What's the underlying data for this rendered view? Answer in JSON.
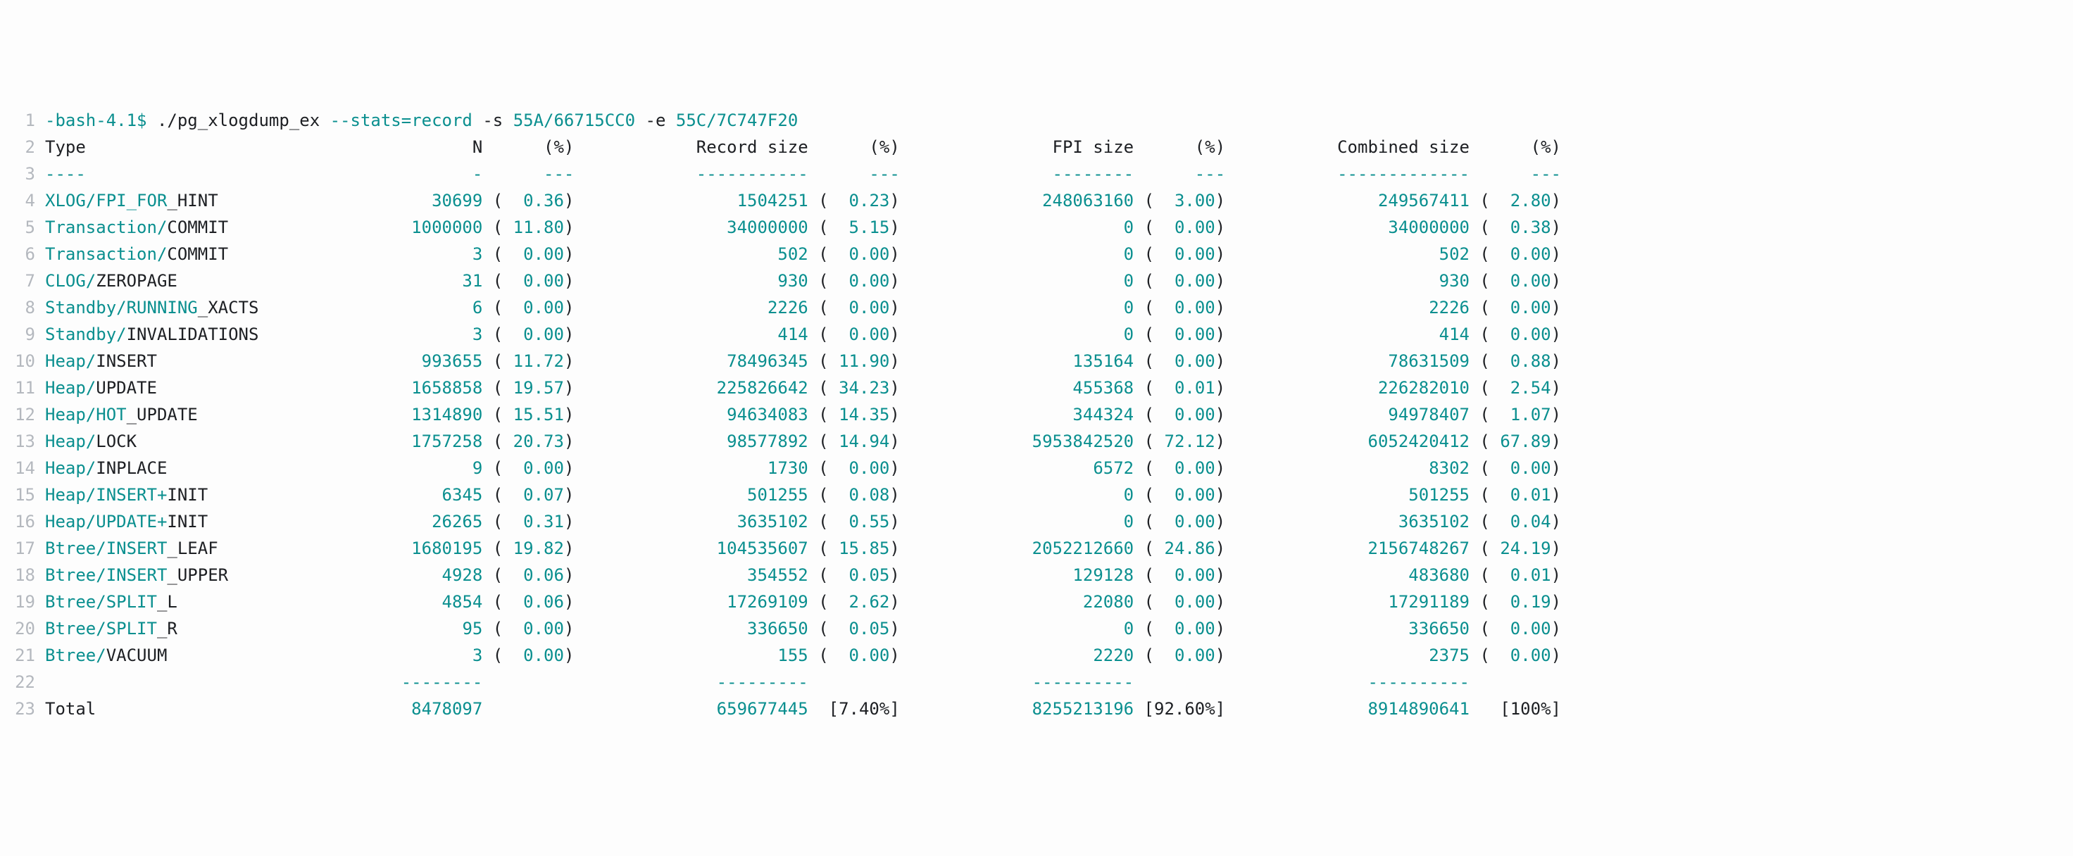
{
  "prompt": {
    "ps1": "-bash-4.1$ ",
    "cmd1": "./pg_xlogdump_ex ",
    "opt1": "--stats=record",
    "flag_s": " -s ",
    "arg_s": "55A/66715CC0",
    "flag_e": " -e ",
    "arg_e": "55C/7C747F20"
  },
  "hdr": {
    "type": "Type",
    "n": "N",
    "pct": "(%)",
    "rsize": "Record size",
    "fsize": "FPI size",
    "csize": "Combined size"
  },
  "div1": {
    "a": "----",
    "b": "-",
    "c": "---",
    "d": "-----------",
    "e": "---",
    "f": "--------",
    "g": "---",
    "h": "-------------",
    "i": "---"
  },
  "rows": [
    {
      "t1": "XLOG/FPI_FOR",
      "t2": "_HINT",
      "n": "30699",
      "np": "0.36",
      "rs": "1504251",
      "rp": "0.23",
      "fs": "248063160",
      "fp": "3.00",
      "cs": "249567411",
      "cp": "2.80"
    },
    {
      "t1": "Transaction/",
      "t2": "COMMIT",
      "n": "1000000",
      "np": "11.80",
      "rs": "34000000",
      "rp": "5.15",
      "fs": "0",
      "fp": "0.00",
      "cs": "34000000",
      "cp": "0.38"
    },
    {
      "t1": "Transaction/",
      "t2": "COMMIT",
      "n": "3",
      "np": "0.00",
      "rs": "502",
      "rp": "0.00",
      "fs": "0",
      "fp": "0.00",
      "cs": "502",
      "cp": "0.00"
    },
    {
      "t1": "CLOG/",
      "t2": "ZEROPAGE",
      "n": "31",
      "np": "0.00",
      "rs": "930",
      "rp": "0.00",
      "fs": "0",
      "fp": "0.00",
      "cs": "930",
      "cp": "0.00"
    },
    {
      "t1": "Standby/RUNNING",
      "t2": "_XACTS",
      "n": "6",
      "np": "0.00",
      "rs": "2226",
      "rp": "0.00",
      "fs": "0",
      "fp": "0.00",
      "cs": "2226",
      "cp": "0.00"
    },
    {
      "t1": "Standby/",
      "t2": "INVALIDATIONS",
      "n": "3",
      "np": "0.00",
      "rs": "414",
      "rp": "0.00",
      "fs": "0",
      "fp": "0.00",
      "cs": "414",
      "cp": "0.00"
    },
    {
      "t1": "Heap/",
      "t2": "INSERT",
      "n": "993655",
      "np": "11.72",
      "rs": "78496345",
      "rp": "11.90",
      "fs": "135164",
      "fp": "0.00",
      "cs": "78631509",
      "cp": "0.88"
    },
    {
      "t1": "Heap/",
      "t2": "UPDATE",
      "n": "1658858",
      "np": "19.57",
      "rs": "225826642",
      "rp": "34.23",
      "fs": "455368",
      "fp": "0.01",
      "cs": "226282010",
      "cp": "2.54"
    },
    {
      "t1": "Heap/HOT",
      "t2": "_UPDATE",
      "n": "1314890",
      "np": "15.51",
      "rs": "94634083",
      "rp": "14.35",
      "fs": "344324",
      "fp": "0.00",
      "cs": "94978407",
      "cp": "1.07"
    },
    {
      "t1": "Heap/",
      "t2": "LOCK",
      "n": "1757258",
      "np": "20.73",
      "rs": "98577892",
      "rp": "14.94",
      "fs": "5953842520",
      "fp": "72.12",
      "cs": "6052420412",
      "cp": "67.89"
    },
    {
      "t1": "Heap/",
      "t2": "INPLACE",
      "n": "9",
      "np": "0.00",
      "rs": "1730",
      "rp": "0.00",
      "fs": "6572",
      "fp": "0.00",
      "cs": "8302",
      "cp": "0.00"
    },
    {
      "t1": "Heap/INSERT+",
      "t2": "INIT",
      "n": "6345",
      "np": "0.07",
      "rs": "501255",
      "rp": "0.08",
      "fs": "0",
      "fp": "0.00",
      "cs": "501255",
      "cp": "0.01"
    },
    {
      "t1": "Heap/UPDATE+",
      "t2": "INIT",
      "n": "26265",
      "np": "0.31",
      "rs": "3635102",
      "rp": "0.55",
      "fs": "0",
      "fp": "0.00",
      "cs": "3635102",
      "cp": "0.04"
    },
    {
      "t1": "Btree/INSERT",
      "t2": "_LEAF",
      "n": "1680195",
      "np": "19.82",
      "rs": "104535607",
      "rp": "15.85",
      "fs": "2052212660",
      "fp": "24.86",
      "cs": "2156748267",
      "cp": "24.19"
    },
    {
      "t1": "Btree/INSERT",
      "t2": "_UPPER",
      "n": "4928",
      "np": "0.06",
      "rs": "354552",
      "rp": "0.05",
      "fs": "129128",
      "fp": "0.00",
      "cs": "483680",
      "cp": "0.01"
    },
    {
      "t1": "Btree/SPLIT",
      "t2": "_L",
      "n": "4854",
      "np": "0.06",
      "rs": "17269109",
      "rp": "2.62",
      "fs": "22080",
      "fp": "0.00",
      "cs": "17291189",
      "cp": "0.19"
    },
    {
      "t1": "Btree/SPLIT",
      "t2": "_R",
      "n": "95",
      "np": "0.00",
      "rs": "336650",
      "rp": "0.05",
      "fs": "0",
      "fp": "0.00",
      "cs": "336650",
      "cp": "0.00"
    },
    {
      "t1": "Btree/",
      "t2": "VACUUM",
      "n": "3",
      "np": "0.00",
      "rs": "155",
      "rp": "0.00",
      "fs": "2220",
      "fp": "0.00",
      "cs": "2375",
      "cp": "0.00"
    }
  ],
  "div2": {
    "a": "--------",
    "b": "---------",
    "c": "----------",
    "d": "----------"
  },
  "total": {
    "label": "Total",
    "n": "8478097",
    "rs": "659677445",
    "rp": "[7.40%]",
    "fs": "8255213196",
    "fp": "[92.60%]",
    "cs": "8914890641",
    "cp": "[100%]"
  },
  "cols": {
    "type": 33,
    "n": 10,
    "np": 6,
    "rs": 23,
    "rp": 6,
    "fs": 23,
    "fp": 6,
    "cs": 24,
    "cp": 6
  }
}
